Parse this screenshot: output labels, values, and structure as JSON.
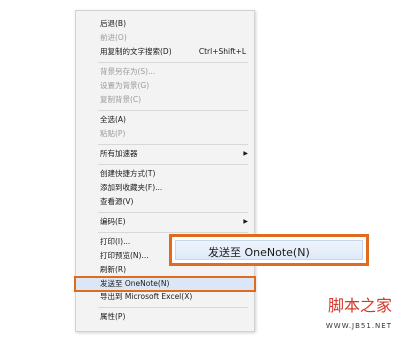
{
  "menu": {
    "items": [
      {
        "label": "后退(B)",
        "disabled": false
      },
      {
        "label": "前进(O)",
        "disabled": true
      },
      {
        "label": "用复制的文字搜索(D)",
        "shortcut": "Ctrl+Shift+L",
        "disabled": false
      },
      {
        "label": "背景另存为(S)...",
        "disabled": true
      },
      {
        "label": "设置为背景(G)",
        "disabled": true
      },
      {
        "label": "复制背景(C)",
        "disabled": true
      },
      {
        "label": "全选(A)",
        "disabled": false
      },
      {
        "label": "粘贴(P)",
        "disabled": true
      },
      {
        "label": "所有加速器",
        "submenu": true,
        "disabled": false
      },
      {
        "label": "创建快捷方式(T)",
        "disabled": false
      },
      {
        "label": "添加到收藏夹(F)...",
        "disabled": false
      },
      {
        "label": "查看源(V)",
        "disabled": false
      },
      {
        "label": "编码(E)",
        "submenu": true,
        "disabled": false
      },
      {
        "label": "打印(I)...",
        "disabled": false
      },
      {
        "label": "打印预览(N)...",
        "disabled": false
      },
      {
        "label": "刷新(R)",
        "disabled": false
      },
      {
        "label": "发送至 OneNote(N)",
        "disabled": false,
        "highlighted": true
      },
      {
        "label": "导出到 Microsoft Excel(X)",
        "disabled": false
      },
      {
        "label": "属性(P)",
        "disabled": false
      }
    ]
  },
  "zoom_callout": {
    "label": "发送至 OneNote(N)"
  },
  "watermark": {
    "title": "脚本之家",
    "url": "WWW.JB51.NET"
  },
  "colors": {
    "highlight_border": "#e06b1e",
    "menu_bg": "#f3f3f3"
  }
}
